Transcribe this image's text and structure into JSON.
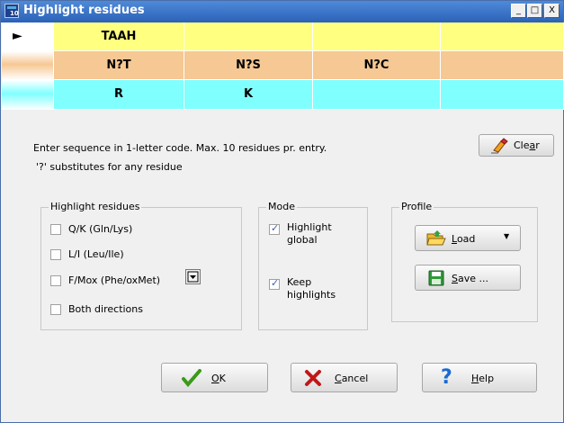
{
  "window": {
    "title": "Highlight residues"
  },
  "titlebar_buttons": {
    "minimize": "_",
    "maximize": "□",
    "close": "X"
  },
  "grid": {
    "rows": [
      {
        "color": "#ffff80",
        "marker": "►",
        "cells": [
          "TAAH",
          "",
          "",
          ""
        ]
      },
      {
        "color": "#f6c894",
        "marker": "",
        "cells": [
          "N?T",
          "N?S",
          "N?C",
          ""
        ]
      },
      {
        "color": "#80ffff",
        "marker": "",
        "cells": [
          "R",
          "K",
          "",
          ""
        ]
      }
    ]
  },
  "instructions": {
    "line1": "Enter sequence in 1-letter code. Max. 10 residues pr. entry.",
    "line2": "'?' substitutes for any residue"
  },
  "clear_button": {
    "label_pre": "Cle",
    "label_u": "a",
    "label_post": "r",
    "icon": "eraser-icon"
  },
  "highlight_group": {
    "title": "Highlight residues",
    "items": [
      {
        "label": "Q/K (Gln/Lys)",
        "checked": false
      },
      {
        "label": "L/I (Leu/Ile)",
        "checked": false
      },
      {
        "label": "F/Mox (Phe/oxMet)",
        "checked": false
      },
      {
        "label": "Both directions",
        "checked": false
      }
    ]
  },
  "mode_group": {
    "title": "Mode",
    "items": [
      {
        "line1": "Highlight",
        "line2": "global",
        "checked": true
      },
      {
        "line1": "Keep",
        "line2": "highlights",
        "checked": true
      }
    ]
  },
  "profile_group": {
    "title": "Profile",
    "load": {
      "u": "L",
      "rest": "oad",
      "icon": "folder-open-icon"
    },
    "save": {
      "u": "S",
      "rest": "ave ...",
      "icon": "floppy-disk-icon"
    }
  },
  "buttons": {
    "ok": {
      "u": "O",
      "rest": "K",
      "icon": "checkmark-icon"
    },
    "cancel": {
      "u": "C",
      "rest": "ancel",
      "icon": "x-icon"
    },
    "help": {
      "u": "H",
      "rest": "elp",
      "icon": "question-icon"
    }
  }
}
